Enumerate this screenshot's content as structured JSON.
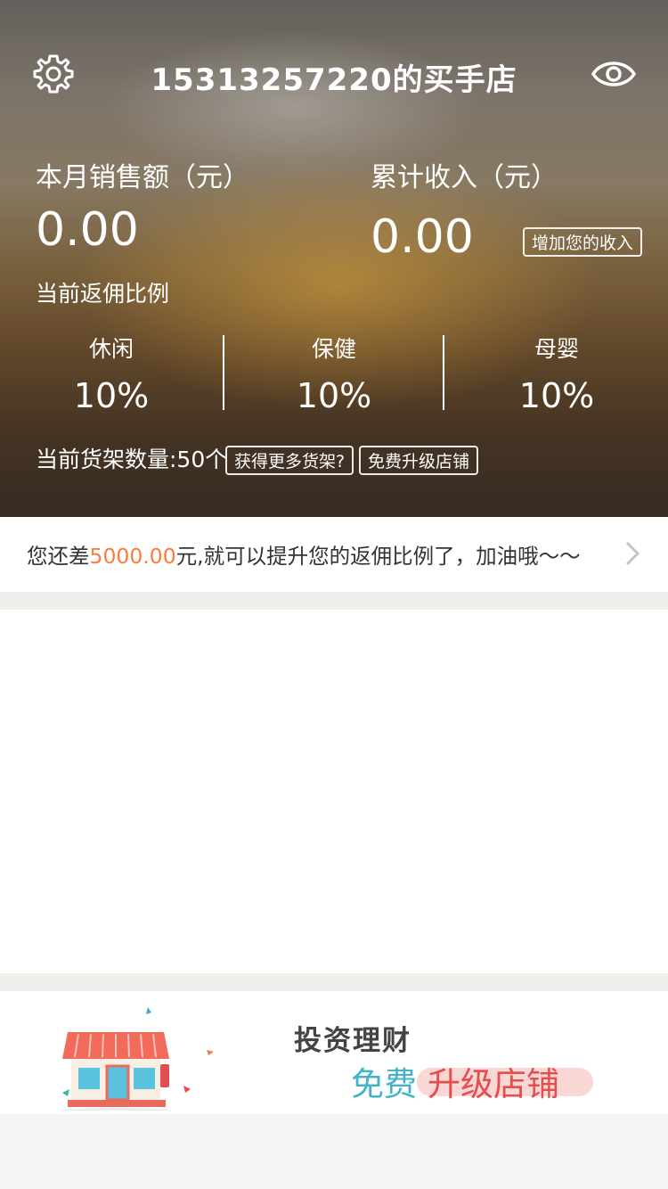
{
  "header": {
    "title": "15313257220的买手店",
    "settings_icon": "gear-icon",
    "visibility_icon": "eye-icon"
  },
  "stats": {
    "monthly_sales_label": "本月销售额（元）",
    "monthly_sales_value": "0.00",
    "total_income_label": "累计收入（元）",
    "total_income_value": "0.00",
    "increase_income_button": "增加您的收入"
  },
  "commission": {
    "label": "当前返佣比例",
    "categories": [
      {
        "name": "休闲",
        "rate": "10%"
      },
      {
        "name": "保健",
        "rate": "10%"
      },
      {
        "name": "母婴",
        "rate": "10%"
      }
    ]
  },
  "shelf": {
    "count_text": "当前货架数量:50个",
    "more_button": "获得更多货架?",
    "upgrade_button": "免费升级店铺"
  },
  "notice": {
    "prefix": "您还差",
    "amount": "5000.00",
    "suffix": "元,就可以提升您的返佣比例了，加油哦～～"
  },
  "banner": {
    "title": "投资理财",
    "subtitle_free": "免费",
    "subtitle_upgrade": "升级店铺"
  },
  "colors": {
    "accent_orange": "#ff7a3d",
    "banner_teal": "#42b4c7",
    "banner_red": "#e44e4e"
  }
}
